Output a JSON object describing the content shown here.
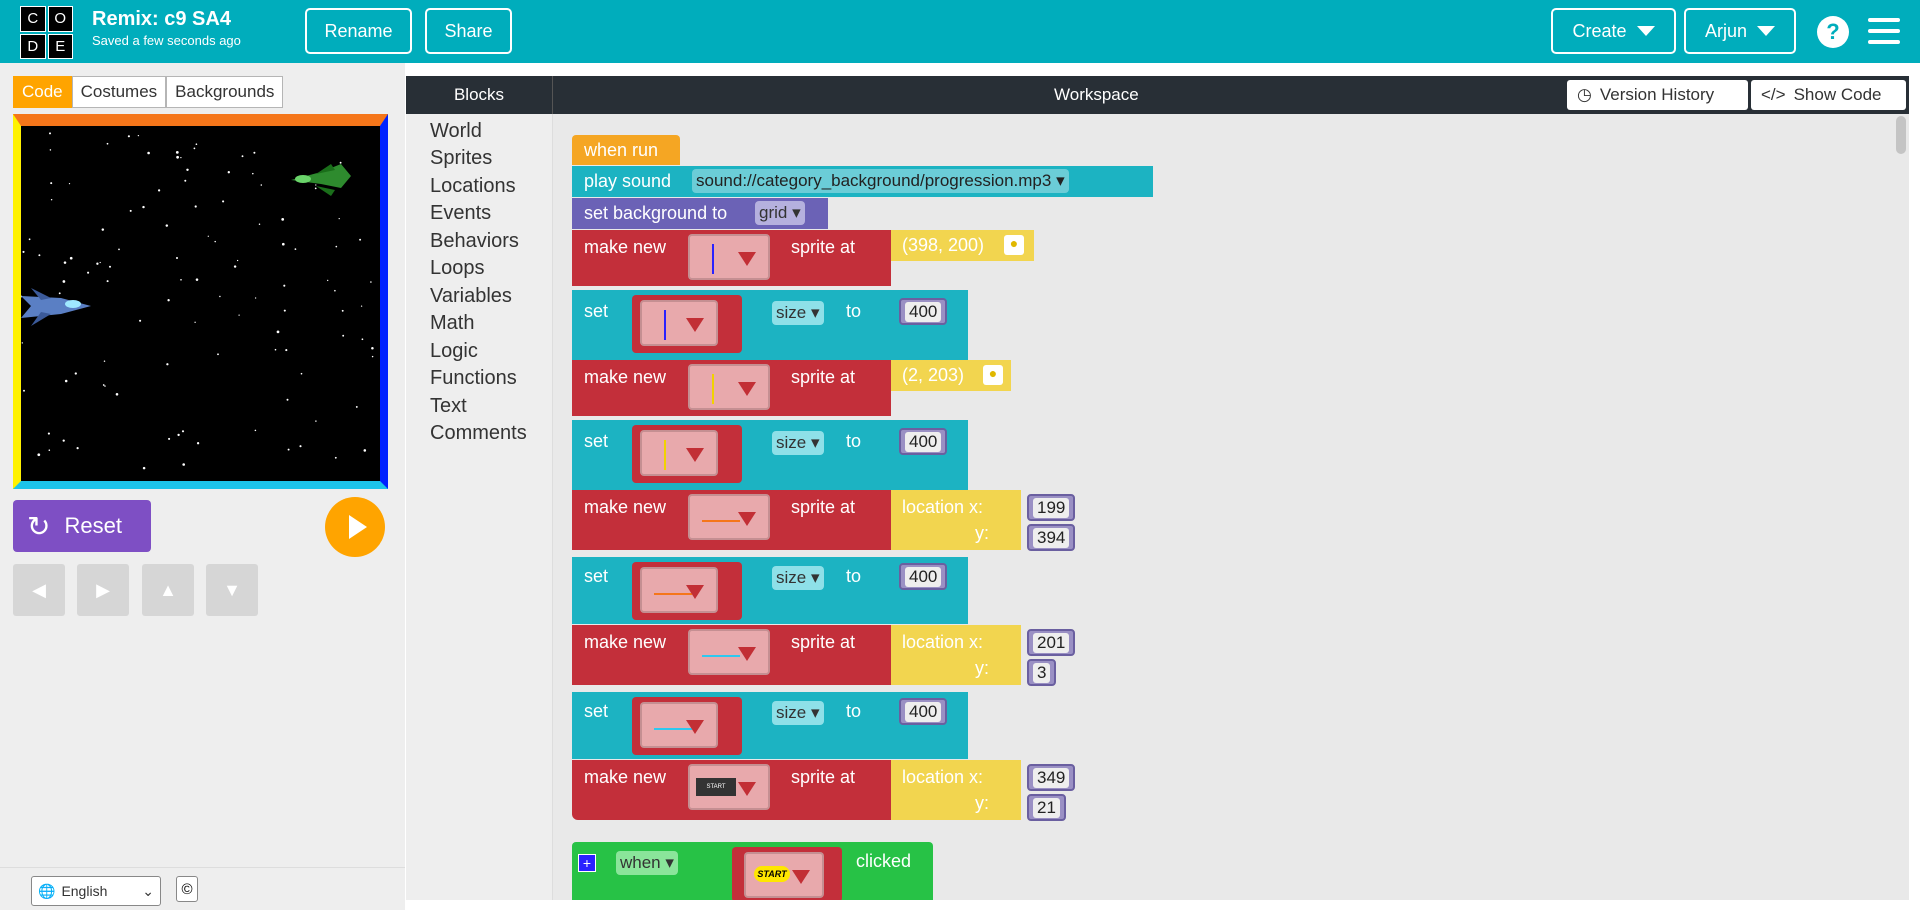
{
  "header": {
    "logo_letters": [
      "C",
      "O",
      "D",
      "E"
    ],
    "project_title": "Remix: c9 SA4",
    "saved_status": "Saved a few seconds ago",
    "rename_label": "Rename",
    "share_label": "Share",
    "create_label": "Create",
    "user_label": "Arjun",
    "help_label": "?"
  },
  "left_tabs": [
    "Code",
    "Costumes",
    "Backgrounds"
  ],
  "controls": {
    "reset_label": "Reset"
  },
  "footer": {
    "language": "English",
    "copyright_symbol": "©"
  },
  "workspace": {
    "blocks_title": "Blocks",
    "workspace_title": "Workspace",
    "version_history_label": "Version History",
    "show_code_label": "Show Code"
  },
  "toolbox": [
    "World",
    "Sprites",
    "Locations",
    "Events",
    "Behaviors",
    "Loops",
    "Variables",
    "Math",
    "Logic",
    "Functions",
    "Text",
    "Comments"
  ],
  "blocks": {
    "when_run": "when run",
    "play_sound": "play sound",
    "sound_value": "sound://category_background/progression.mp3",
    "set_background": "set background to",
    "background_value": "grid",
    "make_new": "make new",
    "sprite_at": "sprite at",
    "set": "set",
    "size": "size",
    "to": "to",
    "loc1": "(398, 200)",
    "loc2": "(2, 203)",
    "size_value": "400",
    "location_x": "location x:",
    "y_label": "y:",
    "x3": "199",
    "y3": "394",
    "x4": "201",
    "y4": "3",
    "x5": "349",
    "y5": "21",
    "start_thumb": "START",
    "when": "when",
    "clicked": "clicked",
    "plus": "+"
  },
  "colors": {
    "header": "#00adbc",
    "event_block": "#f5a623",
    "sound_block": "#1cb3c2",
    "world_block": "#6b62b6",
    "sprite_block": "#c32f3a",
    "location_block": "#f2d54f",
    "number_block": "#9a90c4",
    "event_green": "#27c246"
  }
}
